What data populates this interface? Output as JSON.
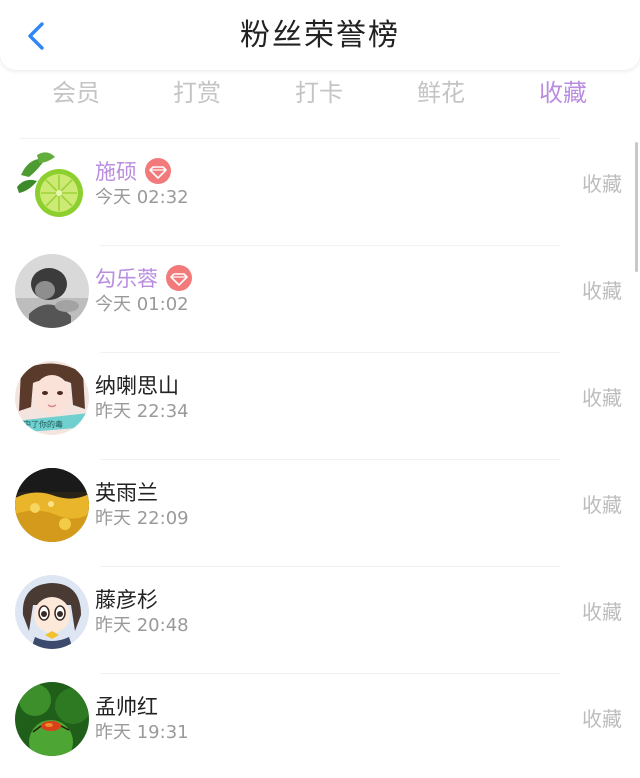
{
  "header": {
    "title": "粉丝荣誉榜"
  },
  "tabs": [
    {
      "label": "会员"
    },
    {
      "label": "打赏"
    },
    {
      "label": "打卡"
    },
    {
      "label": "鲜花"
    },
    {
      "label": "收藏"
    }
  ],
  "active_tab": 4,
  "colors": {
    "accent": "#b98ee0",
    "badge": "#f37a7a",
    "tab_inactive": "#c4c4c4",
    "action_text": "#bdbdbd"
  },
  "fans": [
    {
      "name": "施硕",
      "time": "今天 02:32",
      "action": "收藏",
      "vip": true,
      "avatar_icon": "lime-avatar-icon",
      "avatar_text": ""
    },
    {
      "name": "勾乐蓉",
      "time": "今天 01:02",
      "action": "收藏",
      "vip": true,
      "avatar_icon": "dark-photo-avatar-icon",
      "avatar_text": ""
    },
    {
      "name": "纳喇思山",
      "time": "昨天 22:34",
      "action": "收藏",
      "vip": false,
      "avatar_icon": "girl-photo-avatar-icon",
      "avatar_text": "中了你的毒"
    },
    {
      "name": "英雨兰",
      "time": "昨天 22:09",
      "action": "收藏",
      "vip": false,
      "avatar_icon": "golden-scene-avatar-icon",
      "avatar_text": ""
    },
    {
      "name": "藤彦杉",
      "time": "昨天 20:48",
      "action": "收藏",
      "vip": false,
      "avatar_icon": "anime-character-avatar-icon",
      "avatar_text": ""
    },
    {
      "name": "孟帅红",
      "time": "昨天 19:31",
      "action": "收藏",
      "vip": false,
      "avatar_icon": "green-nature-avatar-icon",
      "avatar_text": ""
    }
  ]
}
